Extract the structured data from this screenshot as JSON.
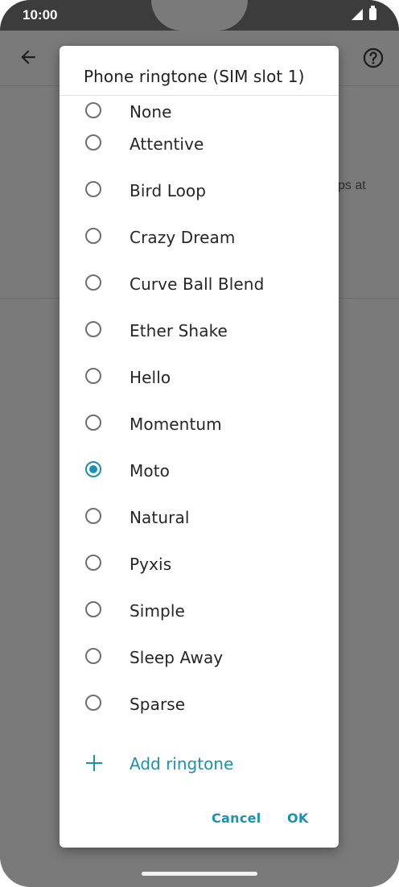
{
  "status_bar": {
    "time": "10:00",
    "icons": [
      "signal-icon",
      "battery-icon"
    ]
  },
  "background_app": {
    "icons": [
      "back-arrow-icon",
      "help-icon"
    ],
    "partial_text": "ps at"
  },
  "dialog": {
    "title": "Phone ringtone (SIM slot 1)",
    "options": [
      {
        "label": "None",
        "selected": false
      },
      {
        "label": "Attentive",
        "selected": false
      },
      {
        "label": "Bird Loop",
        "selected": false
      },
      {
        "label": "Crazy Dream",
        "selected": false
      },
      {
        "label": "Curve Ball Blend",
        "selected": false
      },
      {
        "label": "Ether Shake",
        "selected": false
      },
      {
        "label": "Hello",
        "selected": false
      },
      {
        "label": "Momentum",
        "selected": false
      },
      {
        "label": "Moto",
        "selected": true
      },
      {
        "label": "Natural",
        "selected": false
      },
      {
        "label": "Pyxis",
        "selected": false
      },
      {
        "label": "Simple",
        "selected": false
      },
      {
        "label": "Sleep Away",
        "selected": false
      },
      {
        "label": "Sparse",
        "selected": false
      }
    ],
    "add_ringtone_label": "Add ringtone",
    "cancel_label": "Cancel",
    "ok_label": "OK"
  },
  "colors": {
    "accent": "#1a91b0",
    "scrim": "#7a7a7a",
    "dialog_bg": "#ffffff",
    "text": "#262626"
  }
}
